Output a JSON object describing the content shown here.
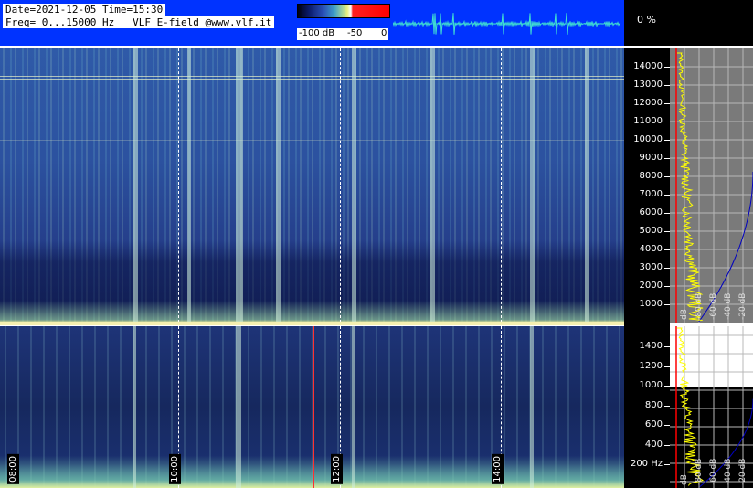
{
  "header": {
    "line1": "Date=2021-12-05 Time=15:30",
    "line2": "Freq= 0...15000 Hz   VLF E-field @www.vlf.it",
    "colorbar_labels": [
      "-100 dB",
      "-50",
      "0"
    ],
    "colors": {
      "background": "#0033ff",
      "waveform": "#40e0d0"
    }
  },
  "percent_indicator": "0 %",
  "spectrogram": {
    "time_labels": [
      "08:00",
      "10:00",
      "12:00",
      "14:00"
    ],
    "colors": {
      "low": "#1a2a66",
      "mid": "#2f5aa8",
      "high": "#f0f0a0",
      "marker": "#ff3030"
    }
  },
  "freq_axis": {
    "hf_labels": [
      "14000",
      "13000",
      "12000",
      "11000",
      "10000",
      "9000",
      "8000",
      "7000",
      "6000",
      "5000",
      "4000",
      "3000",
      "2000",
      "1000"
    ],
    "lf_labels": [
      "1400",
      "1200",
      "1000",
      "800",
      "600",
      "400",
      "200 Hz"
    ]
  },
  "spectrum_panels": {
    "hf_db_labels": [
      "dB",
      "-80 dB",
      "-60 dB",
      "-40 dB",
      "-20 dB"
    ],
    "lf_db_labels": [
      "dB",
      "-80 dB",
      "-60 dB",
      "-40 dB",
      "-20 dB"
    ],
    "colors": {
      "spectrum": "#ffff00",
      "floor": "#0000c0",
      "marker": "#ff0000"
    }
  }
}
